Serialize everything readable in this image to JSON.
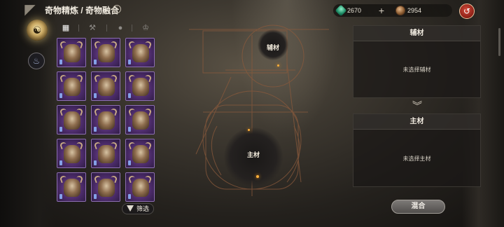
{
  "header": {
    "title": "奇物精炼 / 奇物融合",
    "info_icon": "info-icon",
    "resources": [
      {
        "icon": "green-gem-icon",
        "value": "2670"
      },
      {
        "icon": "bronze-coin-icon",
        "value": "2954"
      }
    ],
    "add_icon": "plus-icon",
    "return_icon": "return-arrow-icon"
  },
  "nav": [
    {
      "icon": "fusion-emblem-icon",
      "active": true
    },
    {
      "icon": "refine-emblem-icon",
      "active": false
    }
  ],
  "tabs": [
    {
      "icon": "grid-icon",
      "glyph": "▦",
      "active": true
    },
    {
      "icon": "hammer-icon",
      "glyph": "⚒",
      "active": false
    },
    {
      "icon": "bomb-icon",
      "glyph": "●",
      "active": false
    },
    {
      "icon": "trophy-icon",
      "glyph": "♔",
      "active": false
    }
  ],
  "inventory": {
    "item_icon": "horned-helmet-icon",
    "rows": 5,
    "columns": 3,
    "filter_label": "筛选"
  },
  "fusion": {
    "aux_slot_label": "辅材",
    "main_slot_label": "主材"
  },
  "aux_panel": {
    "title": "辅材",
    "empty_text": "未选择辅材"
  },
  "main_panel": {
    "title": "主材",
    "empty_text": "未选择主材"
  },
  "actions": {
    "mix_label": "混合"
  },
  "colors": {
    "item_rarity": "#6a3f8f",
    "gem": "#2fb985",
    "return_button": "#b5301f"
  }
}
